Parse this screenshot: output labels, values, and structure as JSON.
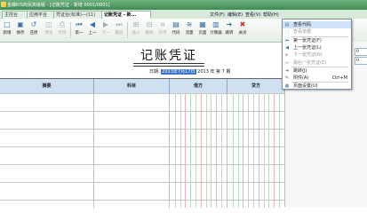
{
  "window": {
    "title": "金蝶KIS商贸高级版 - [记账凭证 - 新增 0001/0001]"
  },
  "menubar": {
    "items": [
      "文件(F)",
      "编辑(E)",
      "查看(V)",
      "帮助(H)"
    ]
  },
  "tabs": [
    {
      "label": "主控台"
    },
    {
      "label": "应用平台"
    },
    {
      "label": "凭证台(标准)—(11)"
    },
    {
      "label": "记账凭证 - 新..."
    }
  ],
  "toolbar": {
    "buttons": [
      {
        "label": "新增",
        "icon": "new-icon"
      },
      {
        "label": "保存",
        "icon": "save-icon"
      },
      {
        "label": "还原",
        "icon": "restore-icon"
      },
      {
        "label": "预览",
        "icon": "preview-icon"
      },
      {
        "label": "打印",
        "icon": "print-icon"
      },
      {
        "label": "第一",
        "icon": "first-icon"
      },
      {
        "label": "上一",
        "icon": "prev-icon"
      },
      {
        "label": "下一",
        "icon": "next-icon"
      },
      {
        "label": "最后",
        "icon": "last-icon"
      },
      {
        "label": "插入",
        "icon": "insert-icon"
      },
      {
        "label": "删除",
        "icon": "delete-icon"
      },
      {
        "label": "外币",
        "icon": "currency-icon"
      },
      {
        "label": "代码",
        "icon": "code-icon"
      },
      {
        "label": "流量",
        "icon": "cashflow-icon"
      },
      {
        "label": "页面",
        "icon": "page-icon"
      },
      {
        "label": "计算器",
        "icon": "calculator-icon"
      },
      {
        "label": "跳转",
        "icon": "jump-icon"
      },
      {
        "label": "关闭",
        "icon": "close-icon"
      }
    ]
  },
  "voucher": {
    "title": "记账凭证",
    "date_label": "日期:",
    "date_value": "2013年7月17日",
    "period": "2013 年 第 7 期"
  },
  "grid": {
    "headers": [
      "摘要",
      "科目",
      "借方",
      "贷方"
    ]
  },
  "context_menu": {
    "items": [
      {
        "label": "查看代码",
        "shortcut": "",
        "enabled": true,
        "icon": "code-icon"
      },
      {
        "label": "查看单据",
        "shortcut": "",
        "enabled": false,
        "icon": "doc-icon"
      },
      {
        "label": "第一张凭证(F)",
        "shortcut": "",
        "enabled": true,
        "icon": "first-icon"
      },
      {
        "label": "上一张凭证(L)",
        "shortcut": "",
        "enabled": true,
        "icon": "prev-icon"
      },
      {
        "label": "下一张凭证(N)",
        "shortcut": "",
        "enabled": false,
        "icon": "next-icon"
      },
      {
        "label": "最后一张凭证(E)",
        "shortcut": "",
        "enabled": false,
        "icon": "last-icon"
      },
      {
        "label": "跳转(J)",
        "shortcut": "",
        "enabled": true,
        "icon": "jump-icon"
      },
      {
        "label": "附件(A)",
        "shortcut": "Ctrl+M",
        "enabled": true,
        "icon": "attach-icon"
      },
      {
        "label": "页面设置(U)",
        "shortcut": "",
        "enabled": true,
        "icon": "page-icon"
      }
    ]
  },
  "right_panel": {
    "fields": [
      {
        "label": "0"
      },
      {
        "label": "0"
      }
    ]
  },
  "colors": {
    "titlebar": "#4a9a5e",
    "header": "#cfe0f1",
    "accent": "#3a74c9"
  }
}
